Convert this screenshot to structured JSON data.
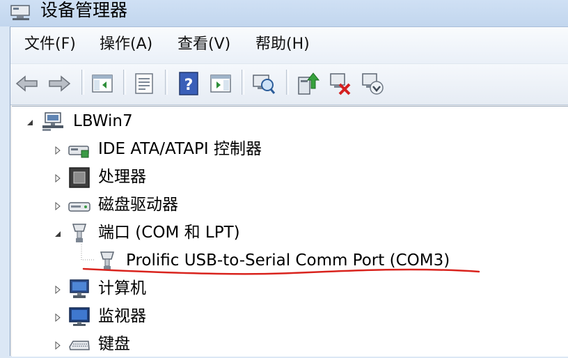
{
  "window": {
    "title": "设备管理器"
  },
  "menu": [
    {
      "label": "文件(F)"
    },
    {
      "label": "操作(A)"
    },
    {
      "label": "查看(V)"
    },
    {
      "label": "帮助(H)"
    }
  ],
  "toolbar": {
    "buttons": [
      {
        "icon": "back-arrow-icon"
      },
      {
        "icon": "forward-arrow-icon"
      },
      {
        "icon": "show-hide-console-tree-icon"
      },
      {
        "icon": "properties-icon"
      },
      {
        "icon": "help-icon"
      },
      {
        "icon": "show-hide-action-pane-icon"
      },
      {
        "icon": "scan-hardware-changes-icon"
      },
      {
        "icon": "update-driver-icon"
      },
      {
        "icon": "uninstall-device-icon"
      },
      {
        "icon": "disable-device-icon"
      }
    ]
  },
  "tree": {
    "root": {
      "label": "LBWin7",
      "icon": "computer-network-icon",
      "expanded": true
    },
    "items": [
      {
        "label": "IDE ATA/ATAPI 控制器",
        "icon": "ide-controller-icon",
        "expanded": false
      },
      {
        "label": "处理器",
        "icon": "processor-icon",
        "expanded": false
      },
      {
        "label": "磁盘驱动器",
        "icon": "disk-drive-icon",
        "expanded": false
      },
      {
        "label": "端口 (COM 和 LPT)",
        "icon": "port-icon",
        "expanded": true,
        "children": [
          {
            "label": "Prolific USB-to-Serial Comm Port (COM3)",
            "icon": "serial-port-icon"
          }
        ]
      },
      {
        "label": "计算机",
        "icon": "computer-icon",
        "expanded": false
      },
      {
        "label": "监视器",
        "icon": "monitor-icon",
        "expanded": false
      },
      {
        "label": "键盘",
        "icon": "keyboard-icon",
        "expanded": false
      }
    ]
  },
  "annotation": {
    "color": "#d9231d"
  }
}
